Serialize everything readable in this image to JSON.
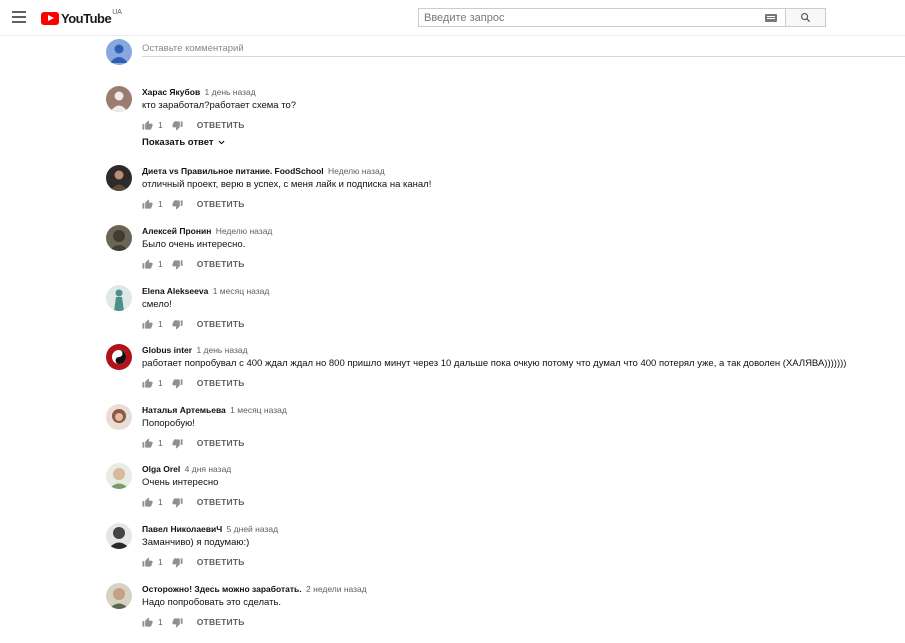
{
  "header": {
    "logo_text": "YouTube",
    "country": "UA",
    "search_placeholder": "Введите запрос"
  },
  "add_comment": {
    "placeholder": "Оставьте комментарий"
  },
  "show_reply_label": "Показать ответ",
  "reply_label": "ОТВЕТИТЬ",
  "comments": [
    {
      "author": "Харас Якубов",
      "time": "1 день назад",
      "text": "кто заработал?работает схема то?",
      "likes": "1",
      "avatar_color": "#9a7c70"
    },
    {
      "author": "Диета vs Правильное питание. FoodSchool",
      "time": "Неделю назад",
      "text": "отличный проект, верю в успех, с меня лайк и подписка на канал!",
      "likes": "1",
      "avatar_color": "#2e2a28"
    },
    {
      "author": "Алексей Пронин",
      "time": "Неделю назад",
      "text": "Было очень интересно.",
      "likes": "1",
      "avatar_color": "#6b6558"
    },
    {
      "author": "Elena Alekseeva",
      "time": "1 месяц назад",
      "text": "смело!",
      "likes": "1",
      "avatar_color": "#4e8f8c"
    },
    {
      "author": "Globus inter",
      "time": "1 день назад",
      "text": "работает  попробувал  с 400 ждал  ждал но 800 пришло минут через 10 дальше пока очкую потому что думал что 400 потерял уже, а так доволен (ХАЛЯВА)))))))",
      "likes": "1",
      "avatar_color": "#b0141a"
    },
    {
      "author": "Наталья Артемьева",
      "time": "1 месяц назад",
      "text": "Попоробую!",
      "likes": "1",
      "avatar_color": "#8a5a48"
    },
    {
      "author": "Olga Orel",
      "time": "4 дня назад",
      "text": "Очень интересно",
      "likes": "1",
      "avatar_color": "#7a9a6a"
    },
    {
      "author": "Павел НиколаевиЧ",
      "time": "5 дней назад",
      "text": "Заманчиво) я подумаю:)",
      "likes": "1",
      "avatar_color": "#2a2a2a"
    },
    {
      "author": "Осторожно! Здесь можно заработать.",
      "time": "2 недели назад",
      "text": "Надо попробовать это сделать.",
      "likes": "1",
      "avatar_color": "#5a6a4a"
    }
  ]
}
